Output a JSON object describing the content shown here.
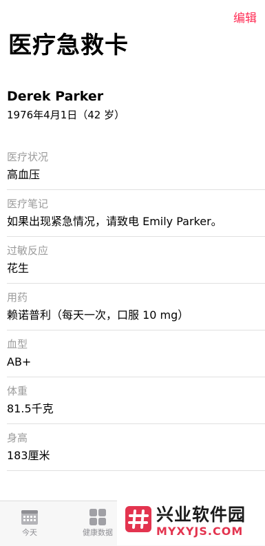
{
  "nav": {
    "edit_label": "编辑",
    "title": "医疗急救卡"
  },
  "profile": {
    "name": "Derek Parker",
    "dob": "1976年4月1日（42 岁）"
  },
  "fields": [
    {
      "label": "医疗状况",
      "value": "高血压"
    },
    {
      "label": "医疗笔记",
      "value": "如果出现紧急情况，请致电 Emily Parker。"
    },
    {
      "label": "过敏反应",
      "value": "花生"
    },
    {
      "label": "用药",
      "value": "赖诺普利（每天一次，口服 10 mg）"
    },
    {
      "label": "血型",
      "value": "AB+"
    },
    {
      "label": "体重",
      "value": "81.5千克"
    },
    {
      "label": "身高",
      "value": "183厘米"
    }
  ],
  "tabbar": {
    "tabs": [
      {
        "label": "今天",
        "icon": "calendar-icon"
      },
      {
        "label": "健康数据",
        "icon": "grid-icon"
      }
    ]
  },
  "watermark": {
    "title": "兴业软件园",
    "subtitle": "MYXYJS.COM"
  },
  "colors": {
    "accent": "#ff2d55",
    "label_gray": "#9b9b9b",
    "divider": "#e0e0e0",
    "tab_gray": "#8e8e93",
    "watermark_red": "#e3344f"
  }
}
